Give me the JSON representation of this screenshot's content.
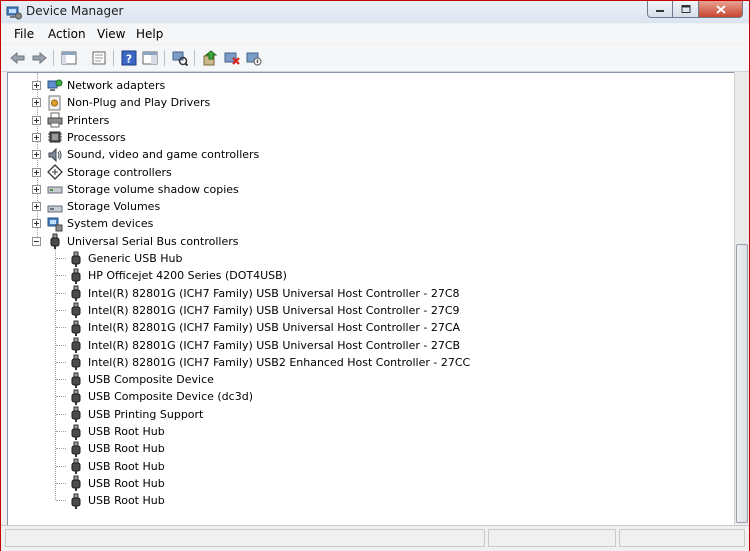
{
  "window": {
    "title": "Device Manager"
  },
  "menu": [
    "File",
    "Action",
    "View",
    "Help"
  ],
  "toolbar": {
    "buttons": [
      "back-icon",
      "forward-icon",
      "console-tree-icon",
      "properties-sheet-icon",
      "help-icon",
      "show-hide-icon",
      "scan-hardware-icon",
      "update-driver-icon",
      "uninstall-icon",
      "disable-icon"
    ]
  },
  "tree": {
    "categories": [
      {
        "label": "Network adapters",
        "icon": "network-icon",
        "expanded": false
      },
      {
        "label": "Non-Plug and Play Drivers",
        "icon": "driver-icon",
        "expanded": false
      },
      {
        "label": "Printers",
        "icon": "printer-icon",
        "expanded": false
      },
      {
        "label": "Processors",
        "icon": "processor-icon",
        "expanded": false
      },
      {
        "label": "Sound, video and game controllers",
        "icon": "sound-icon",
        "expanded": false
      },
      {
        "label": "Storage controllers",
        "icon": "storage-controller-icon",
        "expanded": false
      },
      {
        "label": "Storage volume shadow copies",
        "icon": "shadow-copy-icon",
        "expanded": false
      },
      {
        "label": "Storage Volumes",
        "icon": "volume-icon",
        "expanded": false
      },
      {
        "label": "System devices",
        "icon": "system-icon",
        "expanded": false
      },
      {
        "label": "Universal Serial Bus controllers",
        "icon": "usb-icon",
        "expanded": true
      }
    ],
    "usb_devices": [
      "Generic USB Hub",
      "HP Officejet 4200 Series (DOT4USB)",
      "Intel(R) 82801G (ICH7 Family) USB Universal Host Controller - 27C8",
      "Intel(R) 82801G (ICH7 Family) USB Universal Host Controller - 27C9",
      "Intel(R) 82801G (ICH7 Family) USB Universal Host Controller - 27CA",
      "Intel(R) 82801G (ICH7 Family) USB Universal Host Controller - 27CB",
      "Intel(R) 82801G (ICH7 Family) USB2 Enhanced Host Controller - 27CC",
      "USB Composite Device",
      "USB Composite Device (dc3d)",
      "USB Printing Support",
      "USB Root Hub",
      "USB Root Hub",
      "USB Root Hub",
      "USB Root Hub",
      "USB Root Hub"
    ]
  },
  "colors": {
    "window_border": "#c40000",
    "close_button": "#c9452f",
    "tree_lines": "#a0a0a0"
  }
}
